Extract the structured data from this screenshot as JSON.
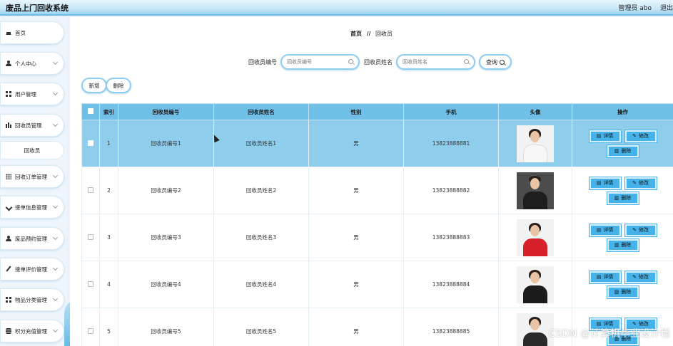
{
  "header": {
    "app_title": "废品上门回收系统",
    "admin_label": "管理员 abo",
    "logout_label": "退出"
  },
  "sidebar": {
    "items": [
      {
        "label": "首页",
        "icon": "home-icon"
      },
      {
        "label": "个人中心",
        "icon": "person-icon"
      },
      {
        "label": "用户管理",
        "icon": "grid-icon"
      },
      {
        "label": "回收员管理",
        "icon": "bar-chart-icon"
      },
      {
        "label": "回收员",
        "icon": ""
      },
      {
        "label": "回收订单管理",
        "icon": "grid9-icon"
      },
      {
        "label": "接单信息管理",
        "icon": "arrow-icon"
      },
      {
        "label": "废品预约管理",
        "icon": "person-icon"
      },
      {
        "label": "接单评价管理",
        "icon": "pen-icon"
      },
      {
        "label": "物品分类管理",
        "icon": "grid-icon"
      },
      {
        "label": "积分充值管理",
        "icon": "database-icon"
      }
    ]
  },
  "breadcrumb": {
    "home": "首页",
    "separator": "//",
    "current": "回收员"
  },
  "search": {
    "field1_label": "回收员编号",
    "field1_placeholder": "回收员编号",
    "field2_label": "回收员姓名",
    "field2_placeholder": "回收员姓名",
    "query_label": "查询"
  },
  "actions": {
    "add_label": "新增",
    "delete_label": "删除"
  },
  "table": {
    "columns": [
      "索引",
      "回收员编号",
      "回收员姓名",
      "性别",
      "手机",
      "头像",
      "操作"
    ],
    "rows": [
      {
        "index": "1",
        "code": "回收员编号1",
        "name": "回收员姓名1",
        "gender": "男",
        "phone": "13823888881",
        "selected": true
      },
      {
        "index": "2",
        "code": "回收员编号2",
        "name": "回收员姓名2",
        "gender": "男",
        "phone": "13823888882",
        "selected": false
      },
      {
        "index": "3",
        "code": "回收员编号3",
        "name": "回收员姓名3",
        "gender": "男",
        "phone": "13823888883",
        "selected": false
      },
      {
        "index": "4",
        "code": "回收员编号4",
        "name": "回收员姓名4",
        "gender": "男",
        "phone": "13823888884",
        "selected": false
      },
      {
        "index": "5",
        "code": "回收员编号5",
        "name": "回收员姓名5",
        "gender": "男",
        "phone": "13823888885",
        "selected": false
      }
    ],
    "row_actions": {
      "detail": "详情",
      "edit": "修改",
      "delete": "删除"
    }
  },
  "watermark": "CSDN @计算机毕业设计程",
  "colors": {
    "accent": "#45b3ea",
    "header_row": "#6fbfe6",
    "selected_row": "#8fcdec"
  }
}
